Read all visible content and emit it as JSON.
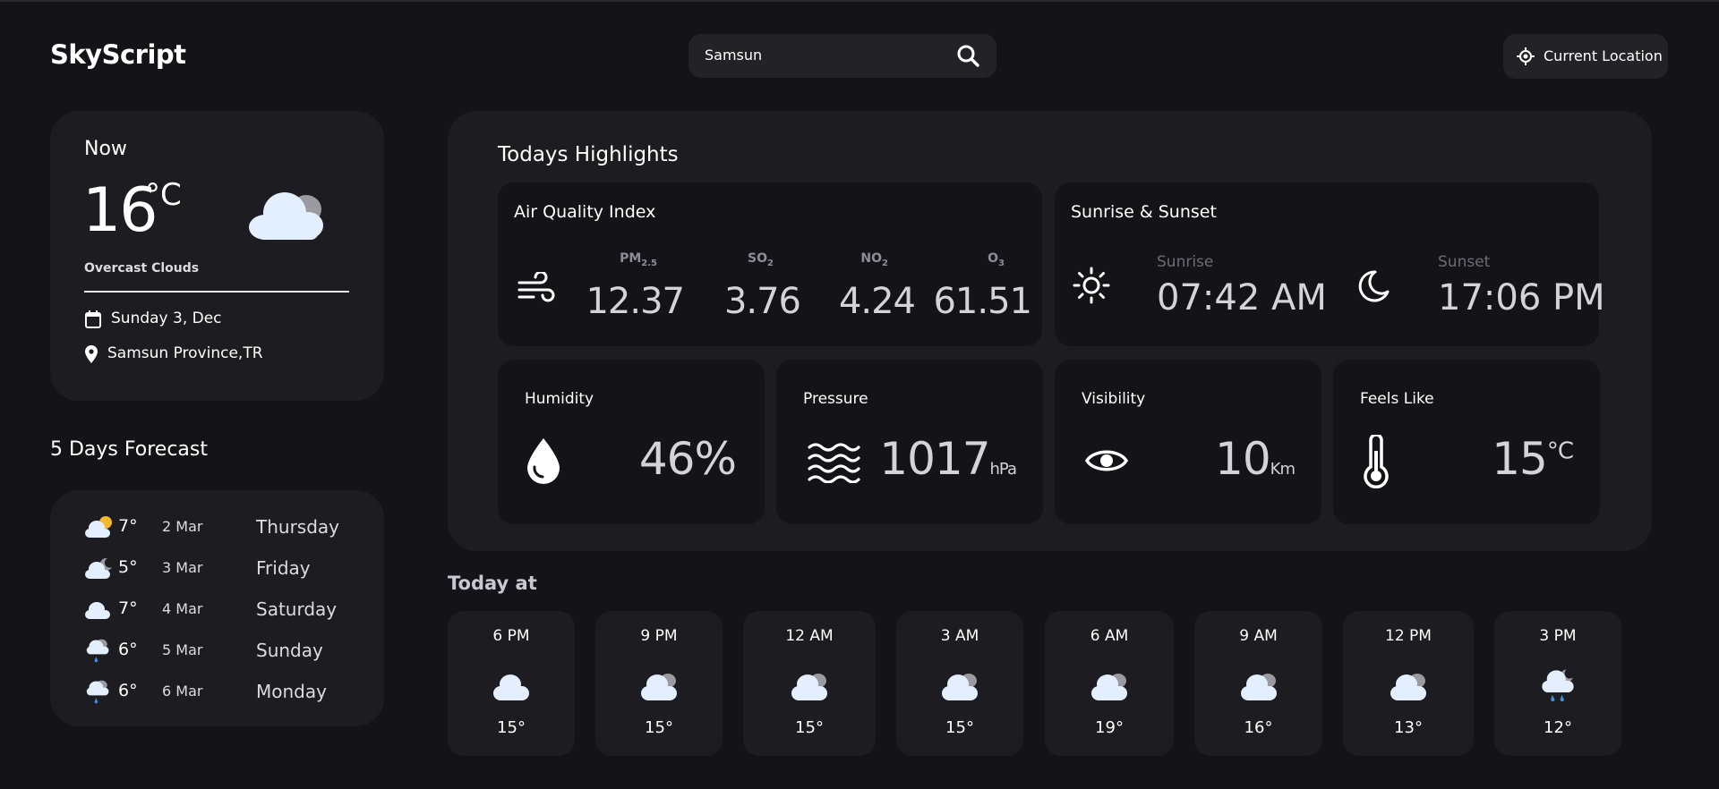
{
  "app": {
    "name": "SkyScript"
  },
  "search": {
    "value": "Samsun"
  },
  "location_button": {
    "label": "Current Location"
  },
  "now": {
    "title": "Now",
    "temp": "16",
    "unit": "°C",
    "condition": "Overcast Clouds",
    "date": "Sunday 3, Dec",
    "location": "Samsun Province,TR",
    "icon": "overcast-clouds-icon"
  },
  "forecast": {
    "title": "5 Days Forecast",
    "days": [
      {
        "temp": "7°",
        "date": "2 Mar",
        "day": "Thursday",
        "icon": "partly-sunny-icon"
      },
      {
        "temp": "5°",
        "date": "3 Mar",
        "day": "Friday",
        "icon": "partly-cloudy-night-icon"
      },
      {
        "temp": "7°",
        "date": "4 Mar",
        "day": "Saturday",
        "icon": "cloud-icon"
      },
      {
        "temp": "6°",
        "date": "5 Mar",
        "day": "Sunday",
        "icon": "rain-icon"
      },
      {
        "temp": "6°",
        "date": "6 Mar",
        "day": "Monday",
        "icon": "rain-icon"
      }
    ]
  },
  "highlights": {
    "title": "Todays Highlights",
    "air_quality": {
      "title": "Air Quality Index",
      "items": [
        {
          "label": "PM",
          "sub": "2.5",
          "value": "12.37"
        },
        {
          "label": "SO",
          "sub": "2",
          "value": "3.76"
        },
        {
          "label": "NO",
          "sub": "2",
          "value": "4.24"
        },
        {
          "label": "O",
          "sub": "3",
          "value": "61.51"
        }
      ]
    },
    "sun": {
      "title": "Sunrise & Sunset",
      "sunrise_label": "Sunrise",
      "sunrise": "07:42 AM",
      "sunset_label": "Sunset",
      "sunset": "17:06 PM"
    },
    "humidity": {
      "label": "Humidity",
      "value": "46%"
    },
    "pressure": {
      "label": "Pressure",
      "value": "1017",
      "unit": "hPa"
    },
    "visibility": {
      "label": "Visibility",
      "value": "10",
      "unit": "Km"
    },
    "feels_like": {
      "label": "Feels Like",
      "value": "15",
      "unit": "°C"
    }
  },
  "today": {
    "title": "Today at",
    "hours": [
      {
        "time": "6 PM",
        "temp": "15°",
        "icon": "cloud-icon"
      },
      {
        "time": "9 PM",
        "temp": "15°",
        "icon": "overcast-clouds-icon"
      },
      {
        "time": "12 AM",
        "temp": "15°",
        "icon": "overcast-clouds-icon"
      },
      {
        "time": "3 AM",
        "temp": "15°",
        "icon": "overcast-clouds-icon"
      },
      {
        "time": "6 AM",
        "temp": "19°",
        "icon": "overcast-clouds-icon"
      },
      {
        "time": "9 AM",
        "temp": "16°",
        "icon": "overcast-clouds-icon"
      },
      {
        "time": "12 PM",
        "temp": "13°",
        "icon": "overcast-clouds-icon"
      },
      {
        "time": "3 PM",
        "temp": "12°",
        "icon": "rain-night-icon"
      }
    ]
  },
  "colors": {
    "background": "#141317",
    "card": "#1d1c21",
    "cloud": "#e3efff",
    "cloud_dark": "#9a9aa0",
    "rain": "#3d8fe0",
    "sun": "#f5b82e"
  }
}
